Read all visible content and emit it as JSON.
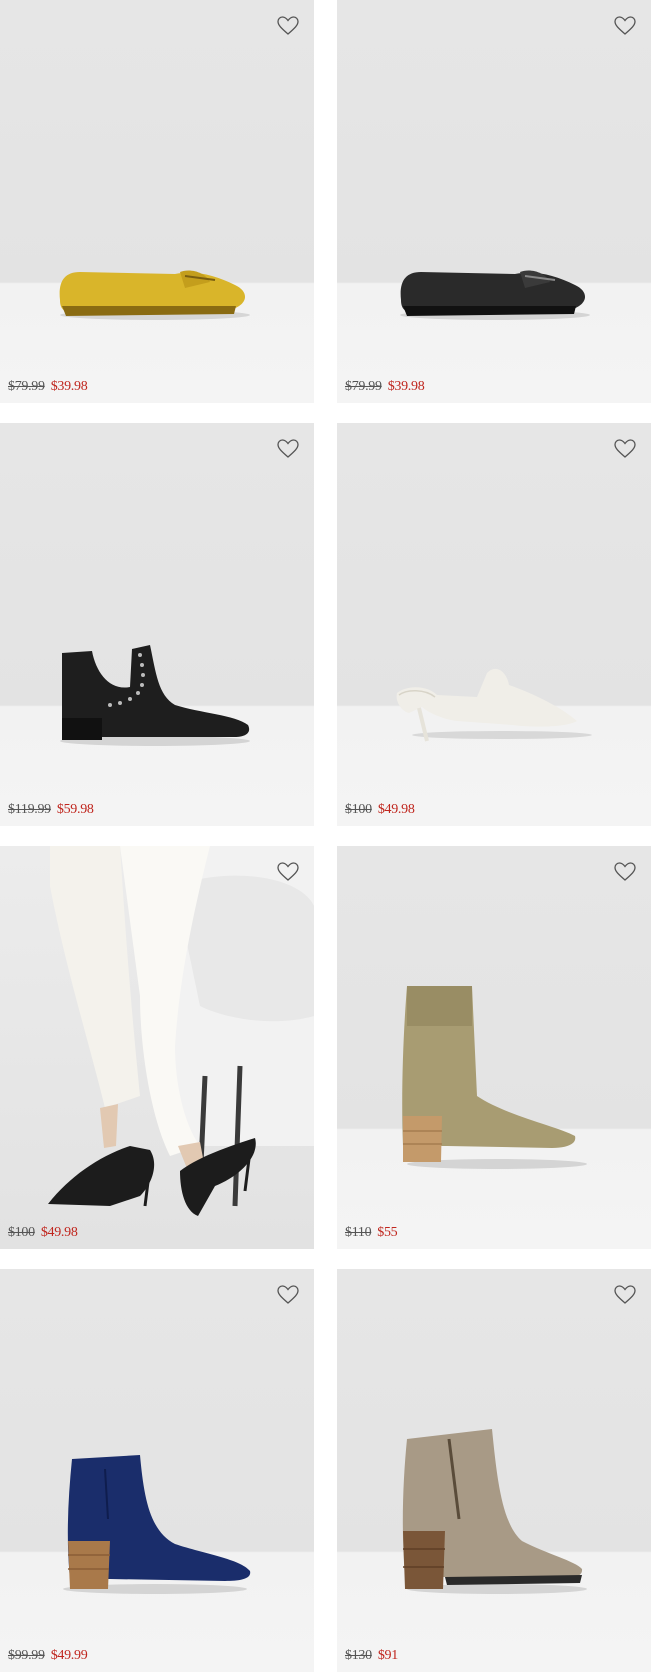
{
  "colors": {
    "sale": "#c0261e",
    "regular": "#555555",
    "card_bg": "#e4e4e4",
    "floor": "#f3f3f3"
  },
  "icons": {
    "favorite": "heart-outline-icon"
  },
  "products": [
    {
      "old_price": "$79.99",
      "sale_price": "$39.98",
      "image": "yellow-suede-moccasin"
    },
    {
      "old_price": "$79.99",
      "sale_price": "$39.98",
      "image": "black-leather-moccasin"
    },
    {
      "old_price": "$119.99",
      "sale_price": "$59.98",
      "image": "black-studded-cutout-bootie"
    },
    {
      "old_price": "$100",
      "sale_price": "$49.98",
      "image": "white-kitten-heel-mule"
    },
    {
      "old_price": "$100",
      "sale_price": "$49.98",
      "image": "model-wearing-black-mules"
    },
    {
      "old_price": "$110",
      "sale_price": "$55",
      "image": "olive-knit-sock-bootie"
    },
    {
      "old_price": "$99.99",
      "sale_price": "$49.99",
      "image": "navy-suede-ankle-boot"
    },
    {
      "old_price": "$130",
      "sale_price": "$91",
      "image": "taupe-zip-ankle-boot"
    }
  ]
}
